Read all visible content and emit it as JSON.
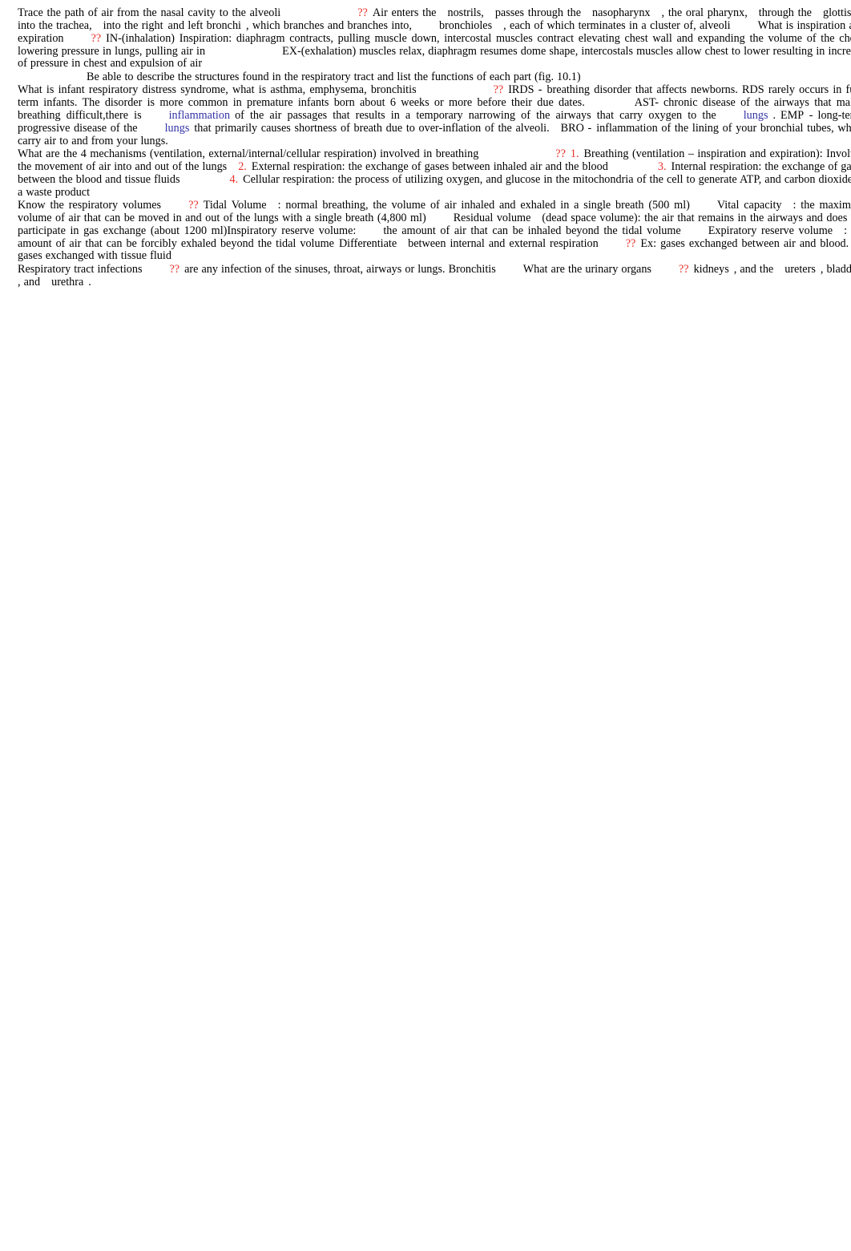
{
  "document": {
    "type": "study-notes",
    "subject": "Respiratory System",
    "text_color": "#000000",
    "mark_color": "#e8302a",
    "link_color": "#3333a8",
    "background": "#ffffff",
    "marker_symbol": "??"
  },
  "content": {
    "q1": {
      "question": "Trace the path of air from the nasal cavity to the alveoli",
      "marker": "??",
      "answer_a": "Air enters the",
      "term_1": "nostrils,",
      "answer_b": "passes through the",
      "term_2": "nasopharynx",
      "answer_c": ", the  oral pharynx,",
      "answer_d": "through the",
      "term_3": "glottis,",
      "answer_e": "into the  trachea,",
      "answer_f": "into the right",
      "answer_g": "and left  bronchi",
      "answer_h": ", which branches and branches into,",
      "term_4": "bronchioles",
      "answer_i": ", each of which terminates in a cluster of, alveoli"
    },
    "q2": {
      "question": "What is inspiration and expiration",
      "marker": "??",
      "answer_a": "IN-(inhalation) Inspiration: diaphragm contracts, pulling muscle down, intercostal muscles contract elevating chest wall and expanding the volume of the chest, lowering pressure in lungs, pulling air in",
      "answer_b": "EX-(exhalation) muscles relax, diaphragm resumes dome shape, intercostals muscles allow chest to lower resulting in increase of pressure in chest and expulsion of air"
    },
    "q3": {
      "question": "Be able to describe the structures found in the respiratory tract and list the functions of each part (fig. 10.1)"
    },
    "q4": {
      "question": "What is infant respiratory distress syndrome, what is asthma, emphysema, bronchitis",
      "marker": "??",
      "irds_label": "IRDS -",
      "irds_text": "breathing disorder that affects newborns. RDS rarely occurs in full-term infants. The disorder is more common in premature infants born about 6 weeks or more before their due dates.",
      "ast_label": "AST-",
      "ast_text_a": "chronic disease of the airways that makes breathing difficult,there is",
      "ast_link": "inflammation",
      "ast_text_b": "of the air passages that results in a temporary narrowing of the airways that carry oxygen to the",
      "ast_link_2": "lungs",
      "ast_text_c": ".",
      "emp_label": "EMP -",
      "emp_text_a": "long-term, progressive disease of the",
      "emp_link": "lungs",
      "emp_text_b": "that primarily causes shortness of breath due to over-inflation of the alveoli.",
      "bro_label": "BRO -",
      "bro_text": "inflammation of the lining of your bronchial tubes, which carry air to and from your lungs."
    },
    "q5": {
      "question": "What are the 4 mechanisms (ventilation, external/internal/cellular respiration) involved in breathing",
      "marker": "??",
      "item_1_num": "1.",
      "item_1_text": "Breathing (ventilation – inspiration and expiration): Involves the movement of air into and out of the lungs",
      "item_2_num": "2.",
      "item_2_text": "External respiration: the exchange of gases between inhaled air and the blood",
      "item_3_num": "3.",
      "item_3_text": "Internal respiration: the exchange of gases between the blood and tissue fluids",
      "item_4_num": "4.",
      "item_4_text": "Cellular respiration: the process of utilizing oxygen, and glucose in the mitochondria of the cell to generate ATP, and carbon dioxide as a waste product"
    },
    "q6": {
      "question": "Know the respiratory volumes",
      "marker": "??",
      "tidal_label": "Tidal Volume",
      "tidal_text": ": normal breathing, the volume of air inhaled and exhaled in a single breath (500 ml)",
      "vital_label": "Vital capacity",
      "vital_text": ": the maximum volume of air that can be moved in and out of the lungs with a single breath (4,800 ml)",
      "residual_label": "Residual volume",
      "residual_text": "(dead space volume): the air that remains in the airways and does not participate in gas exchange (about 1200 ml)",
      "irv_label": "Inspiratory reserve volume:",
      "irv_text": "the amount of air that can be inhaled beyond the tidal volume",
      "erv_label": "Expiratory reserve volume",
      "erv_text": ": the amount of air that can be forcibly exhaled beyond the tidal volume"
    },
    "q7": {
      "question_a": "Differentiate",
      "question_b": "between internal and external respiration",
      "marker": "??",
      "answer": "Ex: gases exchanged between air and blood. In: gases exchanged with tissue fluid"
    },
    "q8": {
      "question": "Respiratory tract infections",
      "marker": "??",
      "answer": "are any infection of the sinuses, throat, airways or lungs. Bronchitis"
    },
    "q9": {
      "question": "What are the urinary organs",
      "marker": "??",
      "answer_a": "kidneys",
      "answer_b": ", and the",
      "term_1": "ureters",
      "answer_c": ", bladder",
      "answer_d": ", and",
      "term_2": "urethra",
      "answer_e": "."
    }
  }
}
